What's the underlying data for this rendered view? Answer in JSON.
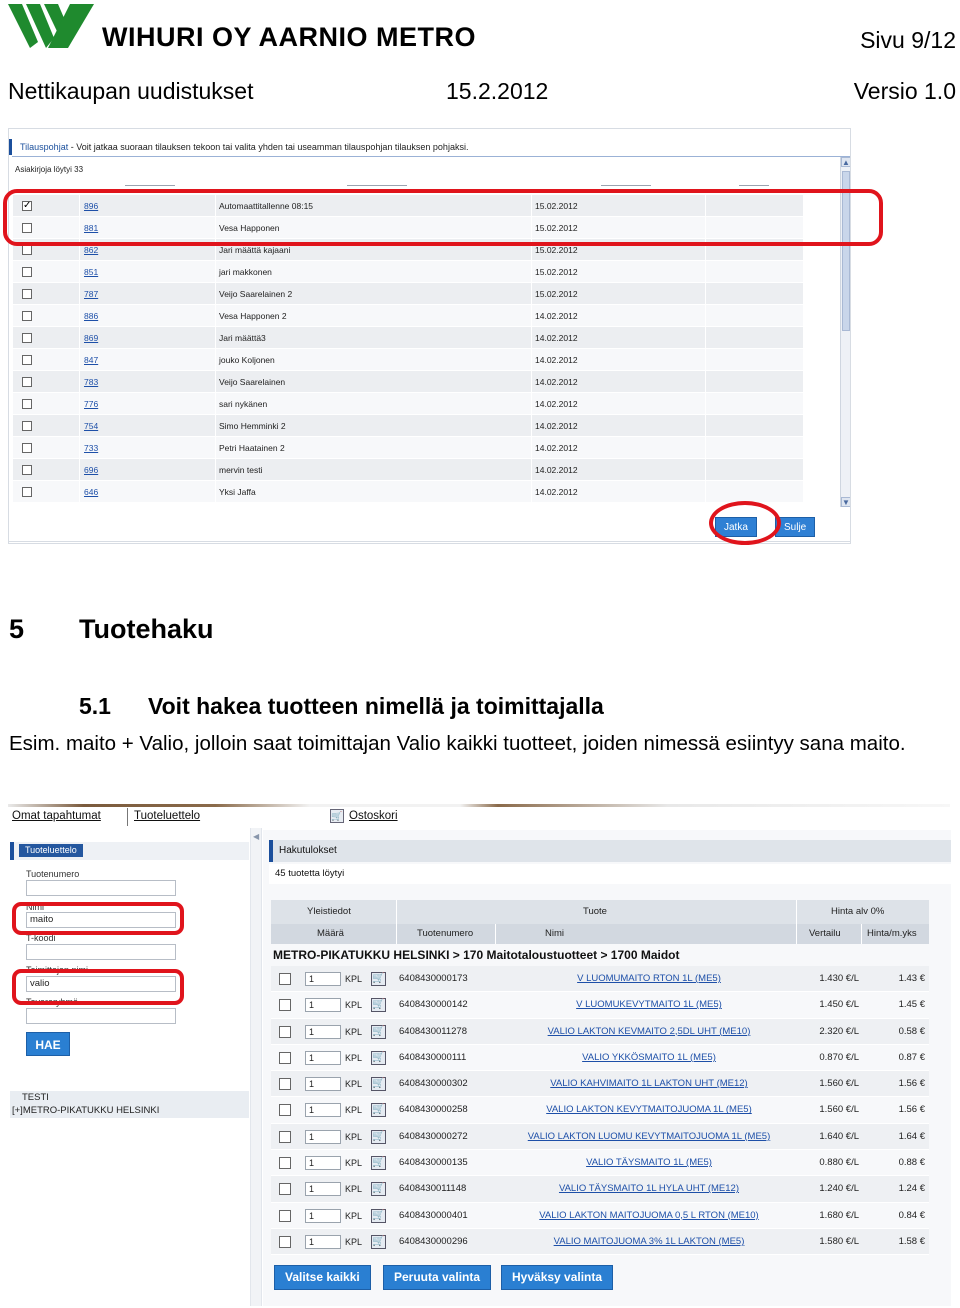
{
  "header": {
    "company": "WIHURI OY AARNIO METRO",
    "page": "Sivu 9/12",
    "doc_title": "Nettikaupan uudistukset",
    "date": "15.2.2012",
    "version": "Versio 1.0"
  },
  "colors": {
    "brand_green": "#1f8a2e",
    "accent_blue": "#2a7fd2",
    "callout_red": "#e0141c"
  },
  "screenshot1": {
    "panel_title": "Tilauspohjat",
    "panel_hint": " - Voit jatkaa suoraan tilauksen tekoon tai valita yhden tai useamman tilauspohjan tilauksen pohjaksi.",
    "result_count": "Asiakirjoja löytyi 33",
    "rows": [
      {
        "num": "896",
        "name": "Automaattitallenne 08:15",
        "date": "15.02.2012",
        "checked": true
      },
      {
        "num": "881",
        "name": "Vesa Happonen",
        "date": "15.02.2012",
        "checked": false
      },
      {
        "num": "862",
        "name": "Jari määttä kajaani",
        "date": "15.02.2012",
        "checked": false
      },
      {
        "num": "851",
        "name": "jari makkonen",
        "date": "15.02.2012",
        "checked": false
      },
      {
        "num": "787",
        "name": "Veijo Saarelainen 2",
        "date": "15.02.2012",
        "checked": false
      },
      {
        "num": "886",
        "name": "Vesa Happonen 2",
        "date": "14.02.2012",
        "checked": false
      },
      {
        "num": "869",
        "name": "Jari määttä3",
        "date": "14.02.2012",
        "checked": false
      },
      {
        "num": "847",
        "name": "jouko Koljonen",
        "date": "14.02.2012",
        "checked": false
      },
      {
        "num": "783",
        "name": "Veijo Saarelainen",
        "date": "14.02.2012",
        "checked": false
      },
      {
        "num": "776",
        "name": "sari nykänen",
        "date": "14.02.2012",
        "checked": false
      },
      {
        "num": "754",
        "name": "Simo Hemminki 2",
        "date": "14.02.2012",
        "checked": false
      },
      {
        "num": "733",
        "name": "Petri Haatainen 2",
        "date": "14.02.2012",
        "checked": false
      },
      {
        "num": "696",
        "name": "mervin testi",
        "date": "14.02.2012",
        "checked": false
      },
      {
        "num": "646",
        "name": "Yksi Jaffa",
        "date": "14.02.2012",
        "checked": false
      }
    ],
    "buttons": {
      "continue": "Jatka",
      "close": "Sulje"
    }
  },
  "section": {
    "number": "5",
    "title": "Tuotehaku",
    "sub_number": "5.1",
    "sub_title": "Voit hakea tuotteen nimellä ja toimittajalla",
    "paragraph": "Esim. maito + Valio, jolloin saat toimittajan Valio kaikki tuotteet, joiden nimessä esiintyy sana maito."
  },
  "screenshot2": {
    "tabs": {
      "events": "Omat tapahtumat",
      "catalog": "Tuoteluettelo",
      "cart": "Ostoskori"
    },
    "left_panel": {
      "title": "Tuoteluettelo",
      "product_number_label": "Tuotenumero",
      "product_number_value": "",
      "name_label": "Nimi",
      "name_value": "maito",
      "tkoodi_label": "T-koodi",
      "tkoodi_value": "",
      "supplier_label": "Toimittajan nimi",
      "supplier_value": "valio",
      "group_label": "Tavararyhmä",
      "group_value": "",
      "search_button": "HAE",
      "tree_root": "TESTI",
      "tree_child": "[+]METRO-PIKATUKKU HELSINKI"
    },
    "results": {
      "title": "Hakutulokset",
      "count": "45 tuotetta löytyi",
      "header_groups": {
        "general": "Yleistiedot",
        "product": "Tuote",
        "price": "Hinta alv 0%"
      },
      "columns": {
        "qty": "Määrä",
        "code": "Tuotenumero",
        "name": "Nimi",
        "compare": "Vertailu",
        "unit": "Hinta/m.yks"
      },
      "category_path": "METRO-PIKATUKKU HELSINKI > 170 Maitotaloustuotteet > 1700 Maidot",
      "rows": [
        {
          "qty": "1",
          "unit": "KPL",
          "code": "6408430000173",
          "name": "V LUOMUMAITO RTON 1L (ME5)",
          "compare": "1.430 €/L",
          "price": "1.43 €"
        },
        {
          "qty": "1",
          "unit": "KPL",
          "code": "6408430000142",
          "name": "V LUOMUKEVYTMAITO 1L (ME5)",
          "compare": "1.450 €/L",
          "price": "1.45 €"
        },
        {
          "qty": "1",
          "unit": "KPL",
          "code": "6408430011278",
          "name": "VALIO LAKTON KEVMAITO 2,5DL UHT (ME10)",
          "compare": "2.320 €/L",
          "price": "0.58 €"
        },
        {
          "qty": "1",
          "unit": "KPL",
          "code": "6408430000111",
          "name": "VALIO YKKÖSMAITO 1L (ME5)",
          "compare": "0.870 €/L",
          "price": "0.87 €"
        },
        {
          "qty": "1",
          "unit": "KPL",
          "code": "6408430000302",
          "name": "VALIO KAHVIMAITO 1L LAKTON UHT (ME12)",
          "compare": "1.560 €/L",
          "price": "1.56 €"
        },
        {
          "qty": "1",
          "unit": "KPL",
          "code": "6408430000258",
          "name": "VALIO LAKTON KEVYTMAITOJUOMA 1L (ME5)",
          "compare": "1.560 €/L",
          "price": "1.56 €"
        },
        {
          "qty": "1",
          "unit": "KPL",
          "code": "6408430000272",
          "name": "VALIO LAKTON LUOMU KEVYTMAITOJUOMA 1L (ME5)",
          "compare": "1.640 €/L",
          "price": "1.64 €"
        },
        {
          "qty": "1",
          "unit": "KPL",
          "code": "6408430000135",
          "name": "VALIO TÄYSMAITO 1L (ME5)",
          "compare": "0.880 €/L",
          "price": "0.88 €"
        },
        {
          "qty": "1",
          "unit": "KPL",
          "code": "6408430011148",
          "name": "VALIO TÄYSMAITO 1L HYLA UHT (ME12)",
          "compare": "1.240 €/L",
          "price": "1.24 €"
        },
        {
          "qty": "1",
          "unit": "KPL",
          "code": "6408430000401",
          "name": "VALIO LAKTON MAITOJUOMA 0,5 L RTON (ME10)",
          "compare": "1.680 €/L",
          "price": "0.84 €"
        },
        {
          "qty": "1",
          "unit": "KPL",
          "code": "6408430000296",
          "name": "VALIO MAITOJUOMA 3% 1L LAKTON (ME5)",
          "compare": "1.580 €/L",
          "price": "1.58 €"
        }
      ],
      "buttons": {
        "select_all": "Valitse kaikki",
        "cancel_selection": "Peruuta valinta",
        "accept_selection": "Hyväksy valinta"
      }
    }
  }
}
